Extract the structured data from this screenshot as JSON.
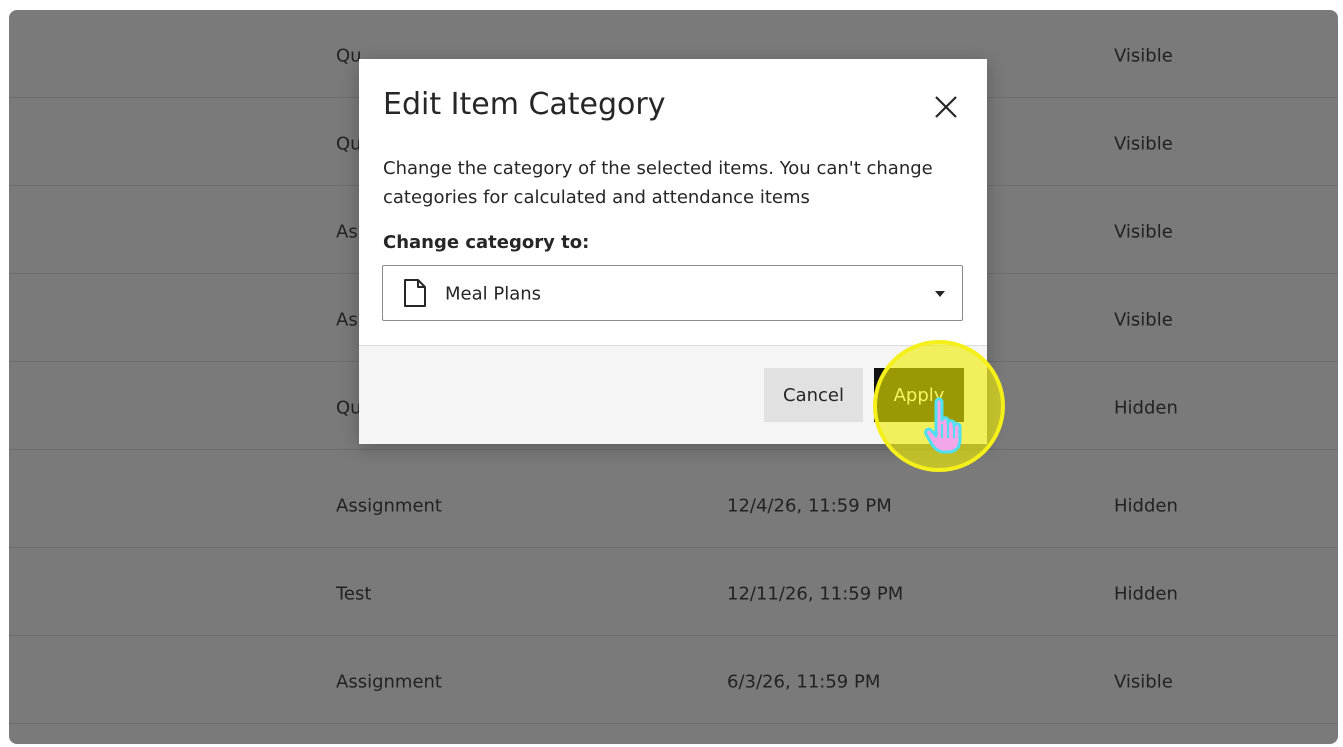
{
  "table": {
    "rows": [
      {
        "type": "Qu",
        "date": "",
        "visibility": "Visible"
      },
      {
        "type": "Qu",
        "date": "",
        "visibility": "Visible"
      },
      {
        "type": "As",
        "date": "",
        "visibility": "Visible"
      },
      {
        "type": "As",
        "date": "",
        "visibility": "Visible"
      },
      {
        "type": "Qu",
        "date": "",
        "visibility": "Hidden"
      },
      {
        "type": "Assignment",
        "date": "12/4/26, 11:59 PM",
        "visibility": "Hidden"
      },
      {
        "type": "Test",
        "date": "12/11/26, 11:59 PM",
        "visibility": "Hidden"
      },
      {
        "type": "Assignment",
        "date": "6/3/26, 11:59 PM",
        "visibility": "Visible"
      }
    ]
  },
  "dialog": {
    "title": "Edit Item Category",
    "close_icon": "close-icon",
    "description": "Change the category of the selected items. You can't change categories for calculated and attendance items",
    "field_label": "Change category to:",
    "select": {
      "icon": "document-icon",
      "selected_value": "Meal Plans"
    },
    "cancel_label": "Cancel",
    "apply_label": "Apply"
  },
  "cursor": {
    "icon": "hand-pointer-icon",
    "highlight_color": "#f5ef1a"
  },
  "colors": {
    "overlay": "#7a7a7a",
    "apply_bg": "#111111",
    "cancel_bg": "#e1e1e1"
  }
}
